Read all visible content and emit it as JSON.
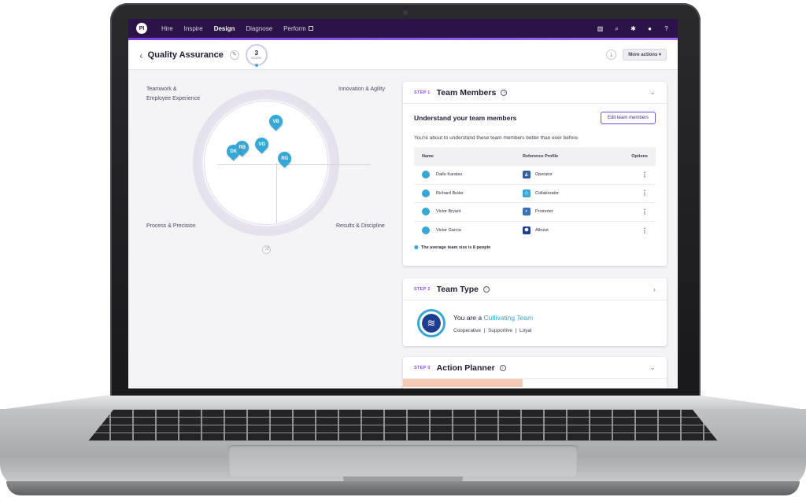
{
  "nav": {
    "logo": "PI",
    "links": [
      "Hire",
      "Inspire",
      "Design",
      "Diagnose",
      "Perform"
    ],
    "active": "Design"
  },
  "header": {
    "title": "Quality Assurance",
    "score_value": "3",
    "score_label": "SCORE",
    "more_actions": "More actions"
  },
  "quadrants": {
    "top_left": "Teamwork &\nEmployee Experience",
    "top_right": "Innovation & Agility",
    "bottom_left": "Process & Precision",
    "bottom_right": "Results & Discipline"
  },
  "pins": [
    "VB",
    "RB",
    "DK",
    "VG",
    "RG"
  ],
  "step1": {
    "tag": "STEP 1",
    "title": "Team Members",
    "subtitle": "Understand your team members",
    "edit_button": "Edit team members",
    "description": "You're about to understand these team members better than ever before.",
    "columns": [
      "Name",
      "Reference Profile",
      "Options"
    ],
    "rows": [
      {
        "name": "Daito Karatsu",
        "profile": "Operator"
      },
      {
        "name": "Richard Butler",
        "profile": "Collaborator"
      },
      {
        "name": "Victor Bryant",
        "profile": "Promoter"
      },
      {
        "name": "Victor Garcia",
        "profile": "Altruist"
      }
    ],
    "note": "The average team size is 8 people"
  },
  "step2": {
    "tag": "STEP 2",
    "title": "Team Type",
    "prefix": "You are a",
    "type_name": "Cultivating Team",
    "traits": "Cooperative  |  Supportive  |  Loyal"
  },
  "step3": {
    "tag": "STEP 3",
    "title": "Action Planner"
  },
  "colors": {
    "nav_bg": "#2a1347",
    "accent_purple": "#7b3fe4",
    "pin_blue": "#36a7d6"
  }
}
